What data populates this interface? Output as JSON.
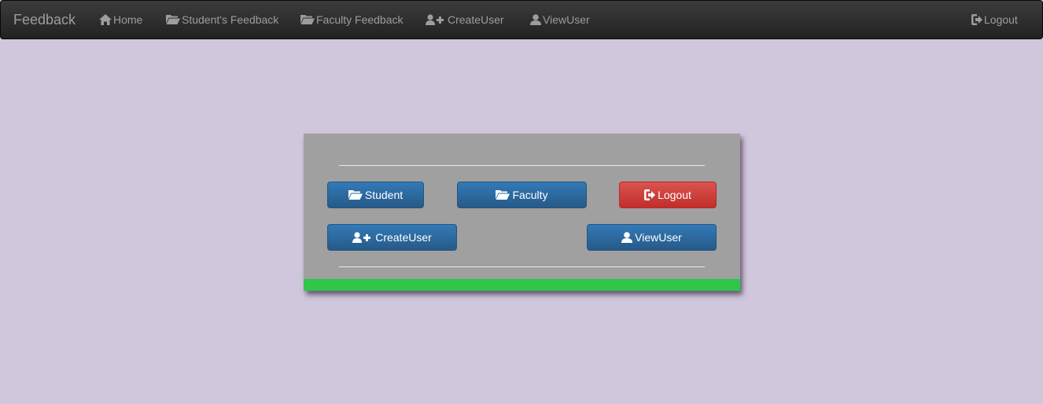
{
  "navbar": {
    "brand": "Feedback",
    "items": [
      {
        "label": "Home",
        "icon": "home-icon"
      },
      {
        "label": "Student's Feedback",
        "icon": "folder-open-icon"
      },
      {
        "label": "Faculty Feedback",
        "icon": "folder-open-icon"
      },
      {
        "label": " CreateUser",
        "icon": "user-plus-icon"
      },
      {
        "label": " ViewUser",
        "icon": "user-icon"
      }
    ],
    "logout": {
      "label": " Logout",
      "icon": "logout-icon"
    }
  },
  "panel": {
    "buttons": {
      "student": {
        "label": "Student",
        "icon": "folder-open-icon"
      },
      "faculty": {
        "label": "Faculty",
        "icon": "folder-open-icon"
      },
      "logout": {
        "label": " Logout",
        "icon": "logout-icon"
      },
      "create_user": {
        "label": " CreateUser",
        "icon": "user-plus-icon"
      },
      "view_user": {
        "label": " ViewUser",
        "icon": "user-icon"
      }
    }
  },
  "colors": {
    "background": "#d0c7dc",
    "navbar": "#222222",
    "panel": "#a0a0a0",
    "footer_bar": "#2fc64a",
    "primary": "#337ab7",
    "danger": "#d9534f"
  }
}
